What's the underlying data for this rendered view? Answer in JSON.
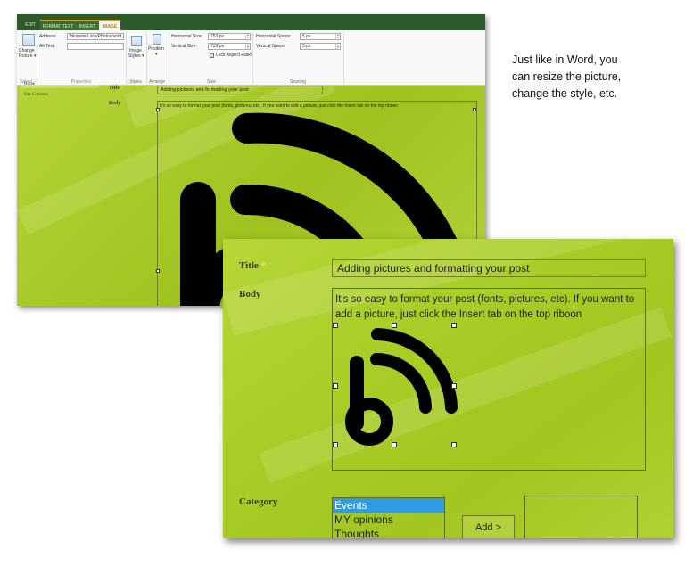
{
  "caption": {
    "line1": "Just like in Word, you",
    "line2": "can resize the picture,",
    "line3": "change the style, etc."
  },
  "back": {
    "tabs": {
      "edit": "EDIT",
      "format_text": "FORMAT TEXT",
      "insert": "INSERT",
      "image": "IMAGE"
    },
    "ribbon": {
      "change_picture_1": "Change",
      "change_picture_2": "Picture ▾",
      "group_select": "Select",
      "address_label": "Address:",
      "address_value": "/blogsite/Lists/Photos/untit",
      "alt_text_label": "Alt Text:",
      "alt_text_value": "",
      "group_properties": "Properties",
      "image_styles_1": "Image",
      "image_styles_2": "Styles ▾",
      "group_styles": "Styles",
      "position_1": "Position",
      "position_2": "▾",
      "group_arrange": "Arrange",
      "h_size_label": "Horizontal Size:",
      "h_size_value": "753 px",
      "v_size_label": "Vertical Size:",
      "v_size_value": "739 px",
      "lock_aspect": "Lock Aspect Ratio",
      "group_size": "Size",
      "h_space_label": "Horizontal Space:",
      "h_space_value": "5 px",
      "v_space_label": "Vertical Space:",
      "v_space_value": "5 px",
      "group_spacing": "Spacing"
    },
    "nav": {
      "home": "Home",
      "site_contents": "Site Contents"
    },
    "form": {
      "title_label": "Title",
      "title_star": "*",
      "title_value": "Adding pictures and formatting your post",
      "body_label": "Body",
      "body_text": "It's so easy to format your post (fonts, pictures, etc).  If you want to add a picture, just click the Insert tab on the top riboon"
    }
  },
  "front": {
    "title_label": "Title",
    "title_star": "*",
    "title_value": "Adding pictures and formatting your post",
    "body_label": "Body",
    "body_text": "It's so easy to format your post (fonts, pictures, etc).  If you want to add a picture, just click the Insert tab on the top riboon",
    "category_label": "Category",
    "categories": [
      "Events",
      "MY opinions",
      "Thoughts"
    ],
    "selected_category": "Events",
    "add_button": "Add >"
  },
  "colors": {
    "lime_background": "#a8cd26",
    "tab_bar": "#2d5a2a",
    "selected_option": "#2e9be2",
    "blog_icon": "#000000"
  },
  "icons": {
    "blog_logo": "rss-b-logo-icon",
    "change_picture": "picture-icon",
    "image_styles": "image-styles-icon",
    "position": "position-icon"
  }
}
